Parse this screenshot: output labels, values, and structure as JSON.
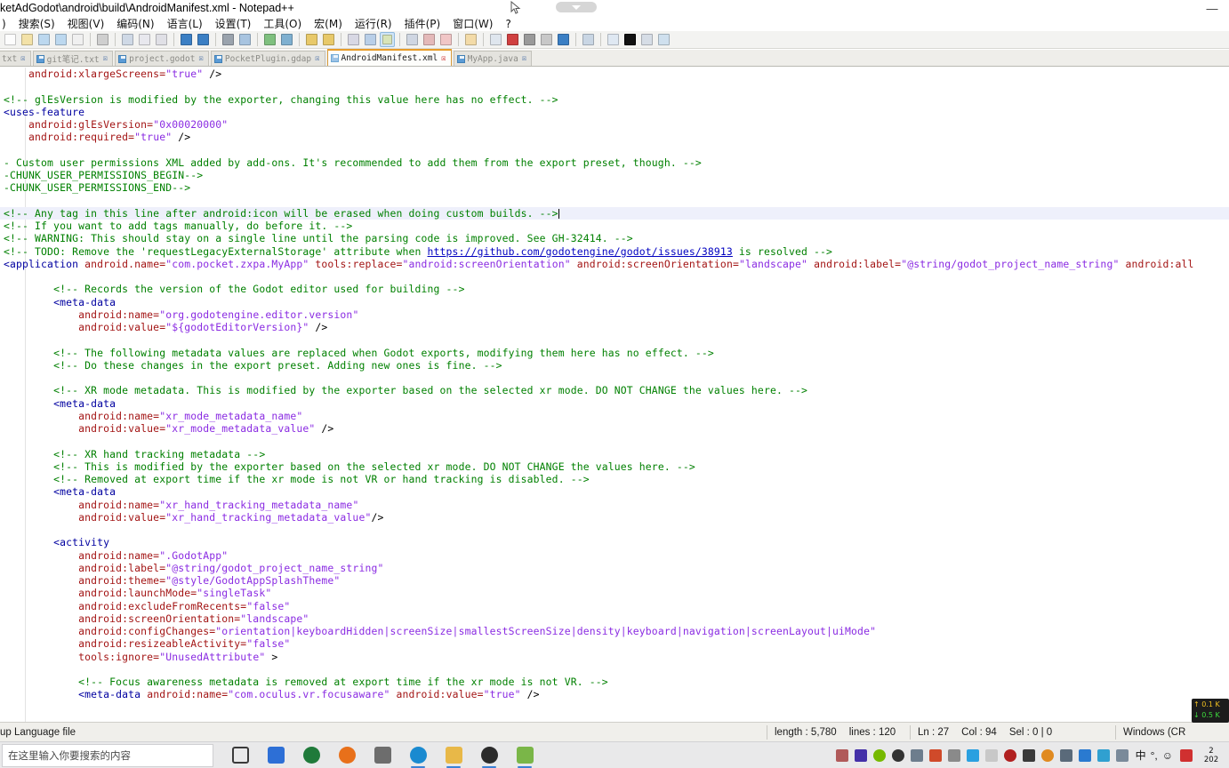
{
  "window": {
    "title": "ketAdGodot\\android\\build\\AndroidManifest.xml - Notepad++",
    "minimize_label": "—",
    "maximize_label": "□",
    "close_label": "✕"
  },
  "menu": {
    "items": [
      {
        "label": ")"
      },
      {
        "label": "搜索(S)"
      },
      {
        "label": "视图(V)"
      },
      {
        "label": "编码(N)"
      },
      {
        "label": "语言(L)"
      },
      {
        "label": "设置(T)"
      },
      {
        "label": "工具(O)"
      },
      {
        "label": "宏(M)"
      },
      {
        "label": "运行(R)"
      },
      {
        "label": "插件(P)"
      },
      {
        "label": "窗口(W)"
      },
      {
        "label": "?"
      }
    ]
  },
  "toolbar": {
    "icons": [
      "new-file-icon",
      "open-file-icon",
      "save-icon",
      "save-all-icon",
      "close-file-icon",
      "print-icon",
      "cut-icon",
      "copy-icon",
      "paste-icon",
      "undo-icon",
      "redo-icon",
      "find-icon",
      "replace-icon",
      "zoom-in-icon",
      "zoom-out-icon",
      "sync-vertical-icon",
      "sync-horizontal-icon",
      "word-wrap-icon",
      "show-all-chars-icon",
      "indent-guide-icon",
      "ui-focus-icon",
      "show-all-icon",
      "user-define-dialog-icon",
      "folder-as-workspace-icon",
      "monitoring-icon",
      "record-macro-icon",
      "stop-macro-icon",
      "playback-macro-icon",
      "run-macro-multiple-icon",
      "save-macro-icon",
      "spell-check-icon",
      "document-map-icon",
      "function-list-icon",
      "plugin-manager-icon"
    ]
  },
  "tabs": [
    {
      "label": "txt",
      "active": false,
      "clipped": true
    },
    {
      "label": "git笔记.txt",
      "active": false
    },
    {
      "label": "project.godot",
      "active": false
    },
    {
      "label": "PocketPlugin.gdap",
      "active": false
    },
    {
      "label": "AndroidManifest.xml",
      "active": true
    },
    {
      "label": "MyApp.java",
      "active": false
    }
  ],
  "editor": {
    "lines": [
      {
        "indent": 4,
        "highlight": false,
        "parts": [
          {
            "t": "at",
            "s": "android:xlargeScreens="
          },
          {
            "t": "vl",
            "s": "\"true\""
          },
          {
            "t": "pl",
            "s": " />"
          }
        ]
      },
      {
        "indent": 0,
        "highlight": false,
        "parts": []
      },
      {
        "indent": 0,
        "highlight": false,
        "parts": [
          {
            "t": "cm",
            "s": "<!-- glEsVersion is modified by the exporter, changing this value here has no effect. -->"
          }
        ]
      },
      {
        "indent": 0,
        "highlight": false,
        "parts": [
          {
            "t": "tg",
            "s": "<uses-feature"
          }
        ]
      },
      {
        "indent": 4,
        "highlight": false,
        "parts": [
          {
            "t": "at",
            "s": "android:glEsVersion="
          },
          {
            "t": "vl",
            "s": "\"0x00020000\""
          }
        ]
      },
      {
        "indent": 4,
        "highlight": false,
        "parts": [
          {
            "t": "at",
            "s": "android:required="
          },
          {
            "t": "vl",
            "s": "\"true\""
          },
          {
            "t": "pl",
            "s": " />"
          }
        ]
      },
      {
        "indent": 0,
        "highlight": false,
        "parts": []
      },
      {
        "indent": 0,
        "highlight": false,
        "parts": [
          {
            "t": "cm",
            "s": "- Custom user permissions XML added by add-ons. It's recommended to add them from the export preset, though. -->"
          }
        ]
      },
      {
        "indent": 0,
        "highlight": false,
        "parts": [
          {
            "t": "cm",
            "s": "-CHUNK_USER_PERMISSIONS_BEGIN-->"
          }
        ]
      },
      {
        "indent": 0,
        "highlight": false,
        "parts": [
          {
            "t": "cm",
            "s": "-CHUNK_USER_PERMISSIONS_END-->"
          }
        ]
      },
      {
        "indent": 0,
        "highlight": false,
        "parts": []
      },
      {
        "indent": 0,
        "highlight": true,
        "parts": [
          {
            "t": "cm",
            "s": "<!-- Any tag in this line after android:icon will be erased when doing custom builds. -->"
          }
        ]
      },
      {
        "indent": 0,
        "highlight": false,
        "parts": [
          {
            "t": "cm",
            "s": "<!-- If you want to add tags manually, do before it. -->"
          }
        ]
      },
      {
        "indent": 0,
        "highlight": false,
        "parts": [
          {
            "t": "cm",
            "s": "<!-- WARNING: This should stay on a single line until the parsing code is improved. See GH-32414. -->"
          }
        ]
      },
      {
        "indent": 0,
        "highlight": false,
        "parts": [
          {
            "t": "cm",
            "s": "<!-- TODO: Remove the 'requestLegacyExternalStorage' attribute when "
          },
          {
            "t": "lk",
            "s": "https://github.com/godotengine/godot/issues/38913"
          },
          {
            "t": "cm",
            "s": " is resolved -->"
          }
        ]
      },
      {
        "indent": 0,
        "highlight": false,
        "parts": [
          {
            "t": "tg",
            "s": "<application "
          },
          {
            "t": "at",
            "s": "android.name="
          },
          {
            "t": "vl",
            "s": "\"com.pocket.zxpa.MyApp\""
          },
          {
            "t": "at",
            "s": " tools:replace="
          },
          {
            "t": "vl",
            "s": "\"android:screenOrientation\""
          },
          {
            "t": "at",
            "s": " android:screenOrientation="
          },
          {
            "t": "vl",
            "s": "\"landscape\""
          },
          {
            "t": "at",
            "s": " android:label="
          },
          {
            "t": "vl",
            "s": "\"@string/godot_project_name_string\""
          },
          {
            "t": "at",
            "s": " android:all"
          }
        ]
      },
      {
        "indent": 0,
        "highlight": false,
        "parts": []
      },
      {
        "indent": 8,
        "highlight": false,
        "parts": [
          {
            "t": "cm",
            "s": "<!-- Records the version of the Godot editor used for building -->"
          }
        ]
      },
      {
        "indent": 8,
        "highlight": false,
        "parts": [
          {
            "t": "tg",
            "s": "<meta-data"
          }
        ]
      },
      {
        "indent": 12,
        "highlight": false,
        "parts": [
          {
            "t": "at",
            "s": "android:name="
          },
          {
            "t": "vl",
            "s": "\"org.godotengine.editor.version\""
          }
        ]
      },
      {
        "indent": 12,
        "highlight": false,
        "parts": [
          {
            "t": "at",
            "s": "android:value="
          },
          {
            "t": "vl",
            "s": "\"${godotEditorVersion}\""
          },
          {
            "t": "pl",
            "s": " />"
          }
        ]
      },
      {
        "indent": 0,
        "highlight": false,
        "parts": []
      },
      {
        "indent": 8,
        "highlight": false,
        "parts": [
          {
            "t": "cm",
            "s": "<!-- The following metadata values are replaced when Godot exports, modifying them here has no effect. -->"
          }
        ]
      },
      {
        "indent": 8,
        "highlight": false,
        "parts": [
          {
            "t": "cm",
            "s": "<!-- Do these changes in the export preset. Adding new ones is fine. -->"
          }
        ]
      },
      {
        "indent": 0,
        "highlight": false,
        "parts": []
      },
      {
        "indent": 8,
        "highlight": false,
        "parts": [
          {
            "t": "cm",
            "s": "<!-- XR mode metadata. This is modified by the exporter based on the selected xr mode. DO NOT CHANGE the values here. -->"
          }
        ]
      },
      {
        "indent": 8,
        "highlight": false,
        "parts": [
          {
            "t": "tg",
            "s": "<meta-data"
          }
        ]
      },
      {
        "indent": 12,
        "highlight": false,
        "parts": [
          {
            "t": "at",
            "s": "android:name="
          },
          {
            "t": "vl",
            "s": "\"xr_mode_metadata_name\""
          }
        ]
      },
      {
        "indent": 12,
        "highlight": false,
        "parts": [
          {
            "t": "at",
            "s": "android:value="
          },
          {
            "t": "vl",
            "s": "\"xr_mode_metadata_value\""
          },
          {
            "t": "pl",
            "s": " />"
          }
        ]
      },
      {
        "indent": 0,
        "highlight": false,
        "parts": []
      },
      {
        "indent": 8,
        "highlight": false,
        "parts": [
          {
            "t": "cm",
            "s": "<!-- XR hand tracking metadata -->"
          }
        ]
      },
      {
        "indent": 8,
        "highlight": false,
        "parts": [
          {
            "t": "cm",
            "s": "<!-- This is modified by the exporter based on the selected xr mode. DO NOT CHANGE the values here. -->"
          }
        ]
      },
      {
        "indent": 8,
        "highlight": false,
        "parts": [
          {
            "t": "cm",
            "s": "<!-- Removed at export time if the xr mode is not VR or hand tracking is disabled. -->"
          }
        ]
      },
      {
        "indent": 8,
        "highlight": false,
        "parts": [
          {
            "t": "tg",
            "s": "<meta-data"
          }
        ]
      },
      {
        "indent": 12,
        "highlight": false,
        "parts": [
          {
            "t": "at",
            "s": "android:name="
          },
          {
            "t": "vl",
            "s": "\"xr_hand_tracking_metadata_name\""
          }
        ]
      },
      {
        "indent": 12,
        "highlight": false,
        "parts": [
          {
            "t": "at",
            "s": "android:value="
          },
          {
            "t": "vl",
            "s": "\"xr_hand_tracking_metadata_value\""
          },
          {
            "t": "pl",
            "s": "/>"
          }
        ]
      },
      {
        "indent": 0,
        "highlight": false,
        "parts": []
      },
      {
        "indent": 8,
        "highlight": false,
        "parts": [
          {
            "t": "tg",
            "s": "<activity"
          }
        ]
      },
      {
        "indent": 12,
        "highlight": false,
        "parts": [
          {
            "t": "at",
            "s": "android:name="
          },
          {
            "t": "vl",
            "s": "\".GodotApp\""
          }
        ]
      },
      {
        "indent": 12,
        "highlight": false,
        "parts": [
          {
            "t": "at",
            "s": "android:label="
          },
          {
            "t": "vl",
            "s": "\"@string/godot_project_name_string\""
          }
        ]
      },
      {
        "indent": 12,
        "highlight": false,
        "parts": [
          {
            "t": "at",
            "s": "android:theme="
          },
          {
            "t": "vl",
            "s": "\"@style/GodotAppSplashTheme\""
          }
        ]
      },
      {
        "indent": 12,
        "highlight": false,
        "parts": [
          {
            "t": "at",
            "s": "android:launchMode="
          },
          {
            "t": "vl",
            "s": "\"singleTask\""
          }
        ]
      },
      {
        "indent": 12,
        "highlight": false,
        "parts": [
          {
            "t": "at",
            "s": "android:excludeFromRecents="
          },
          {
            "t": "vl",
            "s": "\"false\""
          }
        ]
      },
      {
        "indent": 12,
        "highlight": false,
        "parts": [
          {
            "t": "at",
            "s": "android:screenOrientation="
          },
          {
            "t": "vl",
            "s": "\"landscape\""
          }
        ]
      },
      {
        "indent": 12,
        "highlight": false,
        "parts": [
          {
            "t": "at",
            "s": "android:configChanges="
          },
          {
            "t": "vl",
            "s": "\"orientation|keyboardHidden|screenSize|smallestScreenSize|density|keyboard|navigation|screenLayout|uiMode\""
          }
        ]
      },
      {
        "indent": 12,
        "highlight": false,
        "parts": [
          {
            "t": "at",
            "s": "android:resizeableActivity="
          },
          {
            "t": "vl",
            "s": "\"false\""
          }
        ]
      },
      {
        "indent": 12,
        "highlight": false,
        "parts": [
          {
            "t": "at",
            "s": "tools:ignore="
          },
          {
            "t": "vl",
            "s": "\"UnusedAttribute\""
          },
          {
            "t": "pl",
            "s": " >"
          }
        ]
      },
      {
        "indent": 0,
        "highlight": false,
        "parts": []
      },
      {
        "indent": 12,
        "highlight": false,
        "parts": [
          {
            "t": "cm",
            "s": "<!-- Focus awareness metadata is removed at export time if the xr mode is not VR. -->"
          }
        ]
      },
      {
        "indent": 12,
        "highlight": false,
        "parts": [
          {
            "t": "tg",
            "s": "<meta-data "
          },
          {
            "t": "at",
            "s": "android:name="
          },
          {
            "t": "vl",
            "s": "\"com.oculus.vr.focusaware\""
          },
          {
            "t": "at",
            "s": " android:value="
          },
          {
            "t": "vl",
            "s": "\"true\""
          },
          {
            "t": "pl",
            "s": " />"
          }
        ]
      }
    ]
  },
  "statusbar": {
    "doc_type": "up Language file",
    "length_label": "length : 5,780",
    "lines_label": "lines : 120",
    "ln_label": "Ln : 27",
    "col_label": "Col : 94",
    "sel_label": "Sel : 0 | 0",
    "eol_label": "Windows (CR"
  },
  "net_widget": {
    "upload": "↑ 0.1 K",
    "download": "↓ 0.5 K"
  },
  "taskbar": {
    "search_placeholder": "在这里输入你要搜索的内容",
    "apps": [
      "task-view-icon",
      "wps-icon",
      "xmind-icon",
      "firefox-icon",
      "calculator-icon",
      "edge-icon",
      "file-explorer-icon",
      "obs-icon",
      "notepadplusplus-icon"
    ],
    "tray": [
      "display-icon",
      "typora-icon",
      "nvidia-icon",
      "disk-icon",
      "clipboard-icon",
      "volume-icon",
      "mouse-icon",
      "telegram-icon",
      "overflow-icon",
      "obs-tray-icon",
      "mic-icon",
      "firewall-icon",
      "network-icon",
      "speaker-icon",
      "update-icon",
      "bluetooth-icon",
      "sogou-icon"
    ],
    "ime_mode": "中",
    "ime_punct": "°,",
    "ime_smiley": "☺",
    "clock_time": "2",
    "clock_date": "202"
  }
}
